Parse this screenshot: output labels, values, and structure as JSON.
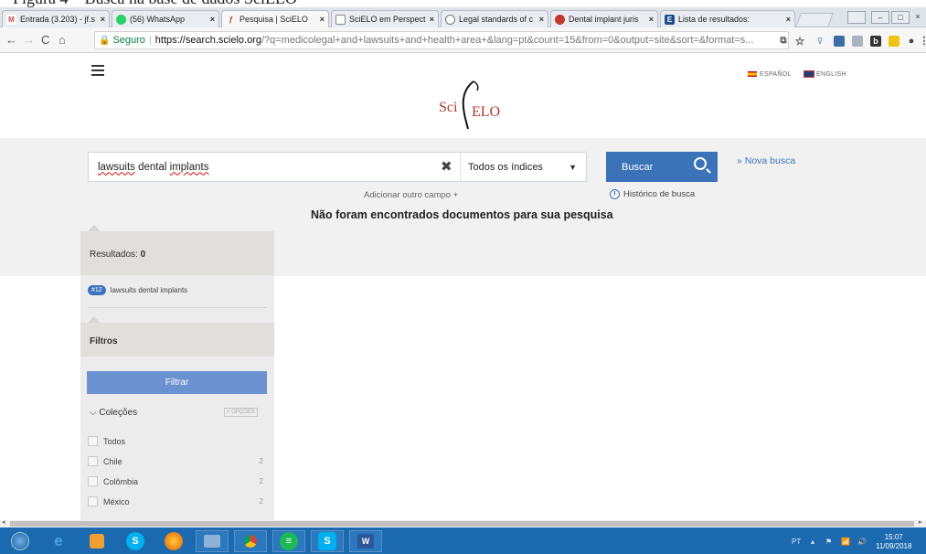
{
  "doc_strip_text": "Figura 4 – Busca na base de dados SciELO",
  "tabs": [
    {
      "label": "Entrada (3.203) - jf.s",
      "icon": "gmail-icon",
      "color": "#d44638",
      "glyph": "M",
      "active": false
    },
    {
      "label": "(56) WhatsApp",
      "icon": "whatsapp-icon",
      "color": "#25d366",
      "glyph": "",
      "active": false
    },
    {
      "label": "Pesquisa | SciELO",
      "icon": "scielo-icon",
      "color": "#ffffff",
      "glyph": "",
      "active": true
    },
    {
      "label": "SciELO em Perspect",
      "icon": "page-icon",
      "color": "#ffffff",
      "glyph": "",
      "active": false
    },
    {
      "label": "Legal standards of c",
      "icon": "globe-icon",
      "color": "#7a7a7a",
      "glyph": "",
      "active": false
    },
    {
      "label": "Dental implant juris",
      "icon": "dental-site-icon",
      "color": "#c0392b",
      "glyph": "",
      "active": false
    },
    {
      "label": "Lista de resultados:",
      "icon": "e-site-icon",
      "color": "#1f4e8c",
      "glyph": "E",
      "active": false
    }
  ],
  "address": {
    "secure_label": "Seguro",
    "host": "https://search.scielo.org",
    "path": "/?q=medicolegal+and+lawsuits+and+health+area+&lang=pt&count=15&from=0&output=site&sort=&format=s..."
  },
  "header": {
    "lang_es": "ESPAÑOL",
    "lang_en": "ENGLISH",
    "logo_sci": "Sci",
    "logo_elo": "ELO"
  },
  "search": {
    "query_word1": "lawsuits",
    "query_word2": " dental ",
    "query_word3": "implants",
    "index_value": "Todos os índices",
    "button_label": "Buscar",
    "nova_busca": "» Nova busca",
    "add_field": "Adicionar outro campo +",
    "history": "Histórico de busca",
    "no_results": "Não foram encontrados documentos para sua pesquisa"
  },
  "results": {
    "label": "Resultados:",
    "count": "0",
    "query_badge": "#12",
    "query_text": "lawsuits dental implants"
  },
  "filters": {
    "title": "Filtros",
    "apply_label": "Filtrar",
    "collections_label": "Coleções",
    "options_label": "+ OPÇÕES",
    "items": [
      {
        "label": "Todos",
        "count": ""
      },
      {
        "label": "Chile",
        "count": "2"
      },
      {
        "label": "Colômbia",
        "count": "2"
      },
      {
        "label": "México",
        "count": "2"
      }
    ]
  },
  "taskbar": {
    "lang": "PT",
    "time": "15:07",
    "date": "11/09/2018"
  }
}
